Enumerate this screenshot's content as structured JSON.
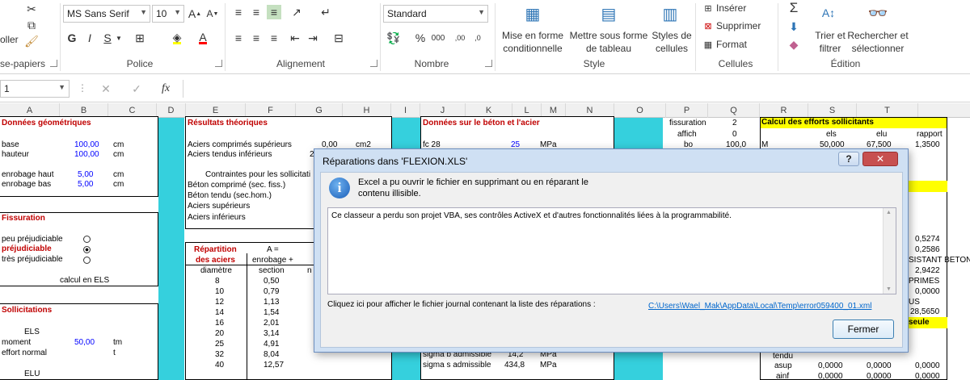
{
  "ribbon": {
    "clipboard": {
      "paste_label": "oller",
      "group_label": "se-papiers"
    },
    "font": {
      "name": "MS Sans Serif",
      "size": "10",
      "bold": "G",
      "italic": "I",
      "underline": "S",
      "group_label": "Police"
    },
    "alignment": {
      "group_label": "Alignement"
    },
    "number": {
      "format": "Standard",
      "percent": "%",
      "thousands": "000",
      "group_label": "Nombre"
    },
    "style": {
      "cond_fmt_1": "Mise en forme",
      "cond_fmt_2": "conditionnelle",
      "table_fmt_1": "Mettre sous forme",
      "table_fmt_2": "de tableau",
      "cell_styles_1": "Styles de",
      "cell_styles_2": "cellules",
      "group_label": "Style"
    },
    "cells": {
      "insert": "Insérer",
      "delete": "Supprimer",
      "format": "Format",
      "group_label": "Cellules"
    },
    "editing": {
      "sort_1": "Trier et",
      "sort_2": "filtrer",
      "find_1": "Rechercher et",
      "find_2": "sélectionner",
      "group_label": "Édition"
    }
  },
  "formula_bar": {
    "name_box": "1",
    "fx": "fx"
  },
  "columns": [
    "A",
    "B",
    "C",
    "D",
    "E",
    "F",
    "G",
    "H",
    "I",
    "J",
    "K",
    "L",
    "M",
    "N",
    "O",
    "P",
    "Q",
    "R",
    "S",
    "T"
  ],
  "sheet": {
    "geo_title": "Données géométriques",
    "base_label": "base",
    "base_val": "100,00",
    "base_unit": "cm",
    "haut_label": "hauteur",
    "haut_val": "100,00",
    "haut_unit": "cm",
    "enrh_label": "enrobage haut",
    "enrh_val": "5,00",
    "enrh_unit": "cm",
    "enrb_label": "enrobage bas",
    "enrb_val": "5,00",
    "enrb_unit": "cm",
    "fiss_title": "Fissuration",
    "fiss_1": "peu préjudiciable",
    "fiss_2": "préjudiciable",
    "fiss_3": "très préjudiciable",
    "calc_els": "calcul en ELS",
    "soll_title": "Sollicitations",
    "els": "ELS",
    "moment_label": "moment",
    "moment_val": "50,00",
    "moment_unit": "tm",
    "effort_label": "effort normal",
    "effort_unit": "t",
    "elu": "ELU",
    "res_title": "Résultats théoriques",
    "acs_label": "Aciers comprimés supérieurs",
    "acs_val": "0,00",
    "acs_unit": "cm2",
    "ati_label": "Aciers tendus inférieurs",
    "ati_val": "2",
    "contr_label": "Contraintes pour les sollicitati",
    "beton_comp": "Béton comprimé (sec. fiss.)",
    "beton_tendu": "Béton tendu (sec.hom.)",
    "ac_sup": "Aciers supérieurs",
    "ac_inf": "Aciers inférieurs",
    "rep_title_1": "Répartition",
    "rep_title_2": "des aciers",
    "rep_a": "A =",
    "rep_enrob": "enrobage +",
    "rep_diam": "diamètre",
    "rep_section": "section",
    "rep_n": "n",
    "rep_rows": [
      [
        "8",
        "0,50"
      ],
      [
        "10",
        "0,79"
      ],
      [
        "12",
        "1,13"
      ],
      [
        "14",
        "1,54"
      ],
      [
        "16",
        "2,01"
      ],
      [
        "20",
        "3,14"
      ],
      [
        "25",
        "4,91"
      ],
      [
        "32",
        "8,04"
      ],
      [
        "40",
        "12,57"
      ]
    ],
    "beton_title": "Données sur le béton et l'acier",
    "fc28_label": "fc 28",
    "fc28_val": "25",
    "fc28_unit": "MPa",
    "sigb_label": "sigma b admissible",
    "sigb_val": "14,2",
    "sigb_unit": "MPa",
    "sigs_label": "sigma s admissible",
    "sigs_val": "434,8",
    "sigs_unit": "MPa",
    "o_fiss": "fissuration",
    "p_fiss": "2",
    "o_affich": "affich",
    "p_affich": "0",
    "o_bo": "bo",
    "p_bo": "100,0",
    "eff_title": "Calcul des efforts sollicitants",
    "r_els": "els",
    "s_elu": "elu",
    "t_rapport": "rapport",
    "q_m": "M",
    "r_m": "50,000",
    "s_m": "67,500",
    "t_m": "1,3500",
    "t_5274": "0,5274",
    "t_2586": "0,2586",
    "t_resist": "SISTANT BETON",
    "t_2942": "2,9422",
    "t_primes": "PRIMES",
    "t_0000": "0,0000",
    "t_us": "US",
    "t_28565": "28,5650",
    "t_seule": "seule",
    "q_tendu": "tendu",
    "q_asup": "asup",
    "r_asup": "0,0000",
    "s_asup": "0,0000",
    "t_asup": "0,0000",
    "q_ainf": "ainf",
    "r_ainf": "0,0000",
    "s_ainf": "0,0000",
    "t_ainf": "0,0000"
  },
  "dialog": {
    "title": "Réparations dans 'FLEXION.XLS'",
    "help": "?",
    "close": "✕",
    "message_1": "Excel a pu ouvrir le fichier en supprimant ou en réparant le",
    "message_2": "contenu illisible.",
    "details": "Ce classeur a perdu son projet VBA, ses contrôles  ActiveX et d'autres fonctionnalités liées à la programmabilité.",
    "log_label": "Cliquez ici pour afficher le fichier journal contenant la liste des réparations :",
    "log_link": "C:\\Users\\Wael_Mak\\AppData\\Local\\Temp\\error059400_01.xml",
    "ok_label": "Fermer"
  }
}
